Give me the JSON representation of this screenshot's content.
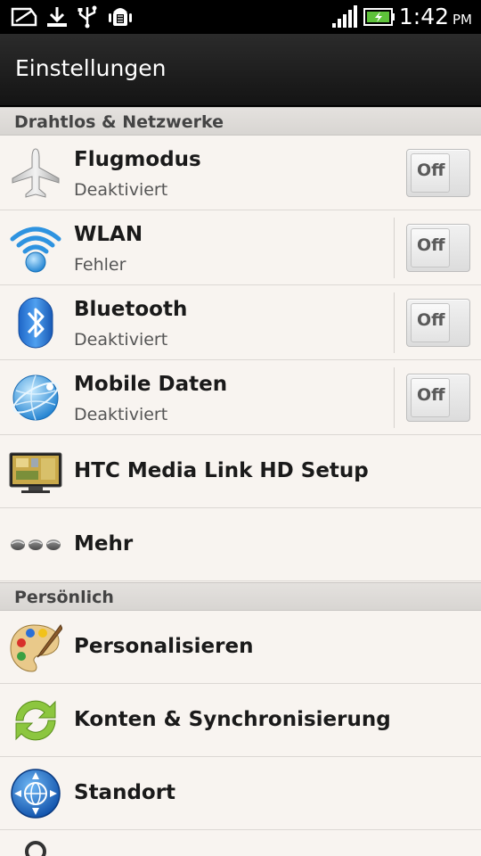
{
  "status_bar": {
    "time": "1:42",
    "ampm": "PM",
    "icons": [
      "notification-icon",
      "download-icon",
      "usb-icon",
      "android-debug-icon",
      "signal-icon",
      "battery-charging-icon"
    ]
  },
  "header": {
    "title": "Einstellungen"
  },
  "sections": {
    "wireless": "Drahtlos & Netzwerke",
    "personal": "Persönlich"
  },
  "items": {
    "flight": {
      "label": "Flugmodus",
      "sub": "Deaktiviert",
      "toggle": "Off",
      "icon": "airplane-icon"
    },
    "wlan": {
      "label": "WLAN",
      "sub": "Fehler",
      "toggle": "Off",
      "icon": "wifi-icon"
    },
    "bluetooth": {
      "label": "Bluetooth",
      "sub": "Deaktiviert",
      "toggle": "Off",
      "icon": "bluetooth-icon"
    },
    "mobile": {
      "label": "Mobile Daten",
      "sub": "Deaktiviert",
      "toggle": "Off",
      "icon": "mobile-data-icon"
    },
    "htc": {
      "label": "HTC Media Link HD Setup",
      "icon": "tv-icon"
    },
    "more": {
      "label": "Mehr",
      "icon": "more-dots-icon"
    },
    "personalize": {
      "label": "Personalisieren",
      "icon": "palette-icon"
    },
    "accounts": {
      "label": "Konten & Synchronisierung",
      "icon": "sync-icon"
    },
    "location": {
      "label": "Standort",
      "icon": "location-globe-icon"
    },
    "search": {
      "icon": "search-icon"
    }
  },
  "colors": {
    "status_bar_bg": "#000000",
    "title_bar_bg": "#1e1e1e",
    "list_bg": "#f8f4f0",
    "section_bg": "#dedbd8",
    "battery_green": "#5ec23a"
  }
}
